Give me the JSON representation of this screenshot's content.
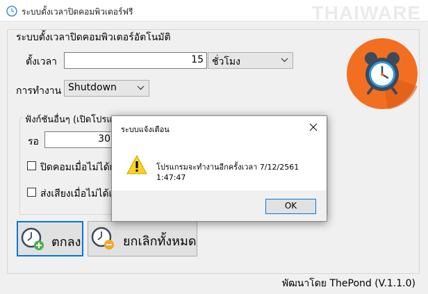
{
  "window": {
    "title": "ระบบตั้งเวลาปิดคอมพิวเตอร์ฟรี",
    "watermark": "THAIWARE"
  },
  "main_group": {
    "legend": "ระบบตั้งเวลาปิดคอมพิวเตอร์อัตโนมัติ",
    "time_label": "ตั้งเวลา",
    "time_value": "15",
    "unit_selected": "ชั่วโมง",
    "action_label": "การทำงาน",
    "action_selected": "Shutdown"
  },
  "options_group": {
    "legend": "ฟังก์ชันอื่นๆ (เปิดโปรแก",
    "wait_label": "รอ",
    "wait_value": "30",
    "checkbox1_label": "ปิดคอมเมื่อไม่ได้เชื่",
    "checkbox2_label": "ส่งเสียงเมื่อไม่ได้เชื่",
    "checkbox1_checked": false,
    "checkbox2_checked": false
  },
  "buttons": {
    "ok_label": "ตกลง",
    "cancel_all_label": "ยกเลิกทั้งหมด"
  },
  "footer": {
    "credit": "พัฒนาโดย ThePond (V.1.1.0)"
  },
  "dialog": {
    "title": "ระบบแจ้งเตือน",
    "message": "โปรแกรมจะทำงานอีกครั้งเวลา 7/12/2561 1:47:47",
    "ok_label": "OK",
    "icon": "warning-icon"
  },
  "colors": {
    "accent_blue": "#0078d7",
    "clock_orange": "#f26f21",
    "warning_yellow": "#f9d51c"
  }
}
